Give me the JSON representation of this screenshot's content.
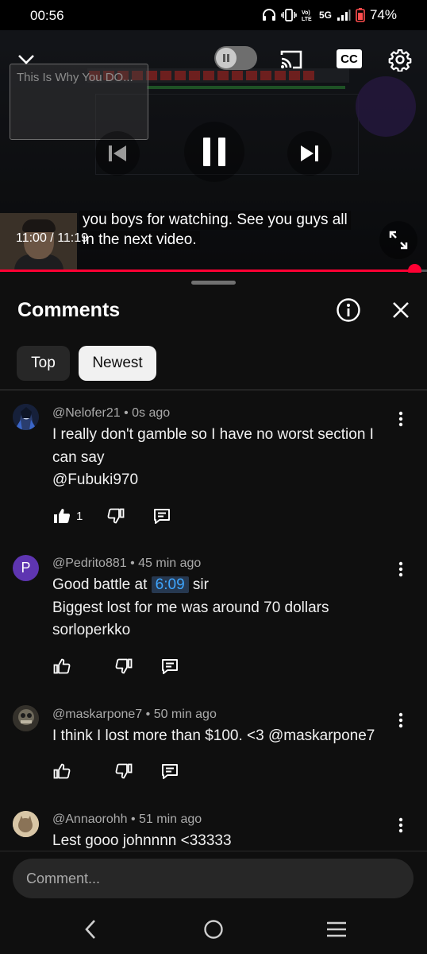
{
  "status_bar": {
    "time": "00:56",
    "network": "5G",
    "battery": "74%",
    "icons": [
      "headphones-icon",
      "vibrate-icon",
      "volte-icon",
      "signal-icon",
      "battery-icon"
    ]
  },
  "player": {
    "video_title": "This Is Why You DO...",
    "cc_label": "CC",
    "caption_line1": "you boys for watching. See you guys all",
    "caption_line2": "in the next video.",
    "timecode": "11:00 / 11:19",
    "progress": 0.97,
    "colors": {
      "progress": "#ff0033"
    }
  },
  "comments_panel": {
    "title": "Comments",
    "tabs": [
      {
        "label": "Top",
        "selected": false
      },
      {
        "label": "Newest",
        "selected": true
      }
    ],
    "comments": [
      {
        "author": "@Nelofer21",
        "time": "0s ago",
        "lines": [
          "I really don't gamble so I have no worst section I",
          "can say",
          "@Fubuki970"
        ],
        "likes": "1",
        "liked": true
      },
      {
        "author": "@Pedrito881",
        "time": "45 min ago",
        "avatar_letter": "P",
        "text_before_ts": "Good battle at",
        "timestamp": "6:09",
        "text_after_ts": "sir",
        "lines": [
          "Biggest lost for me was around 70 dollars",
          "sorloperkko"
        ],
        "likes": "",
        "liked": false
      },
      {
        "author": "@maskarpone7",
        "time": "50 min ago",
        "lines": [
          "I think I lost more than $100. <3 @maskarpone7"
        ],
        "likes": "",
        "liked": false
      },
      {
        "author": "@Annaorohh",
        "time": "51 min ago",
        "lines": [
          "Lest gooo johnnnn <33333"
        ],
        "likes": "",
        "liked": false
      }
    ],
    "input_placeholder": "Comment..."
  },
  "nav_bar": {
    "buttons": [
      "back-icon",
      "home-icon",
      "recents-icon"
    ]
  }
}
